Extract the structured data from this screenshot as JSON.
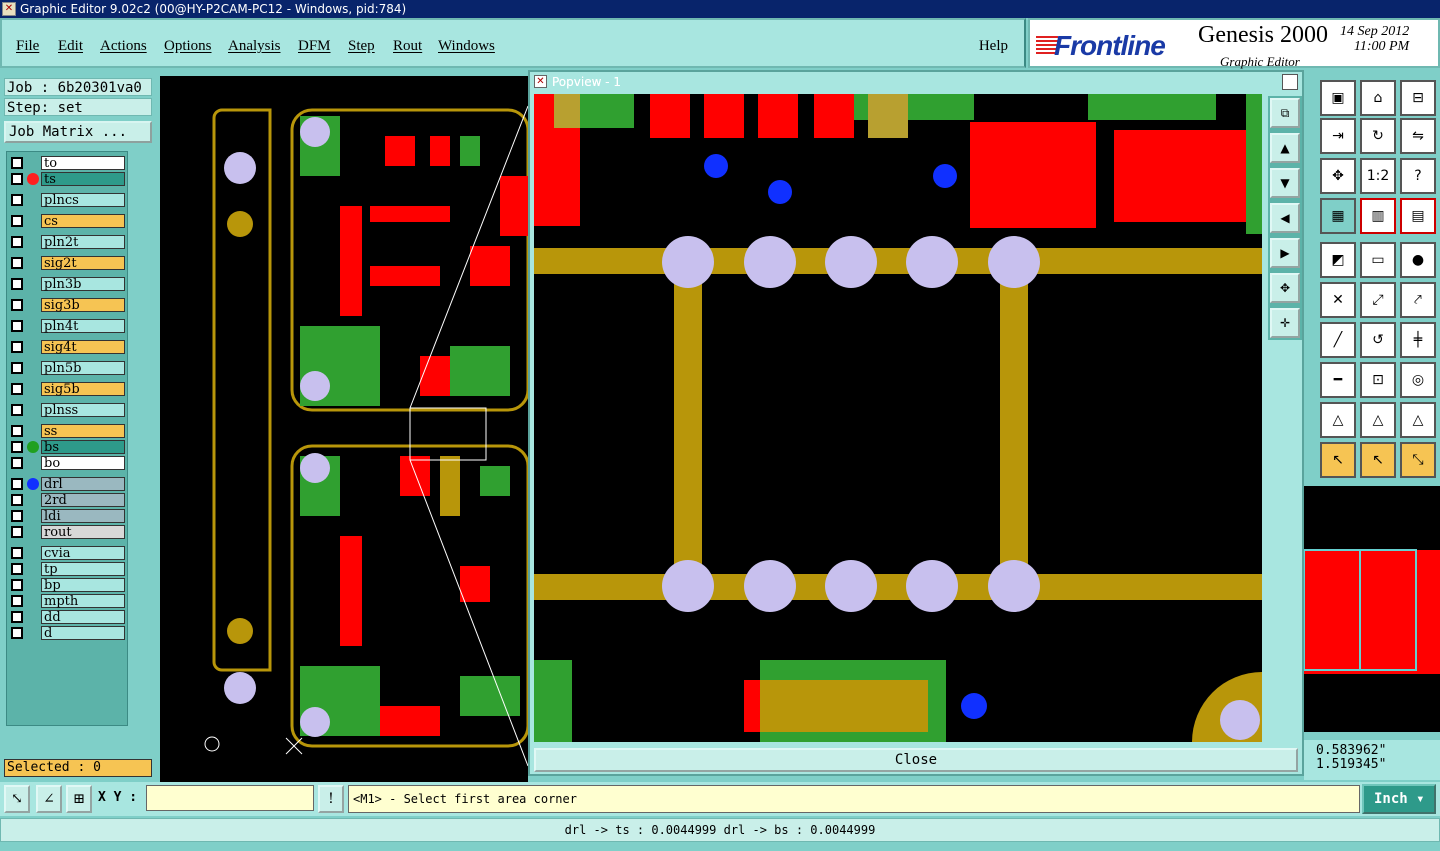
{
  "window": {
    "title": "Graphic Editor 9.02c2 (00@HY-P2CAM-PC12 - Windows, pid:784)"
  },
  "menu": {
    "items": [
      "File",
      "Edit",
      "Actions",
      "Options",
      "Analysis",
      "DFM",
      "Step",
      "Rout",
      "Windows"
    ],
    "help": "Help"
  },
  "brand": {
    "logo": "Frontline",
    "product": "Genesis 2000",
    "subtitle": "Graphic Editor",
    "date": "14 Sep 2012",
    "time": "11:00 PM"
  },
  "job": {
    "job_label": "Job : 6b20301va0",
    "step_label": "Step: set",
    "matrix_button": "Job Matrix ..."
  },
  "layers": [
    {
      "name": "to",
      "bg": "#ffffff",
      "dot": ""
    },
    {
      "name": "ts",
      "bg": "#2e9a8a",
      "dot": "#ff2020"
    },
    {
      "name": "plncs",
      "bg": "#a8e6e0",
      "dot": ""
    },
    {
      "name": "cs",
      "bg": "#f6c453",
      "dot": ""
    },
    {
      "name": "pln2t",
      "bg": "#a8e6e0",
      "dot": ""
    },
    {
      "name": "sig2t",
      "bg": "#f6c453",
      "dot": ""
    },
    {
      "name": "pln3b",
      "bg": "#a8e6e0",
      "dot": ""
    },
    {
      "name": "sig3b",
      "bg": "#f6c453",
      "dot": ""
    },
    {
      "name": "pln4t",
      "bg": "#a8e6e0",
      "dot": ""
    },
    {
      "name": "sig4t",
      "bg": "#f6c453",
      "dot": ""
    },
    {
      "name": "pln5b",
      "bg": "#a8e6e0",
      "dot": ""
    },
    {
      "name": "sig5b",
      "bg": "#f6c453",
      "dot": ""
    },
    {
      "name": "plnss",
      "bg": "#a8e6e0",
      "dot": ""
    },
    {
      "name": "ss",
      "bg": "#f6c453",
      "dot": ""
    },
    {
      "name": "bs",
      "bg": "#2e9a8a",
      "dot": "#20a020"
    },
    {
      "name": "bo",
      "bg": "#ffffff",
      "dot": ""
    },
    {
      "name": "drl",
      "bg": "#9ab8c0",
      "dot": "#1030ff"
    },
    {
      "name": "2rd",
      "bg": "#9ab8c0",
      "dot": ""
    },
    {
      "name": "ldi",
      "bg": "#9ab8c0",
      "dot": ""
    },
    {
      "name": "rout",
      "bg": "#d8d8d8",
      "dot": ""
    },
    {
      "name": "cvia",
      "bg": "#a8e6e0",
      "dot": ""
    },
    {
      "name": "tp",
      "bg": "#a8e6e0",
      "dot": ""
    },
    {
      "name": "bp",
      "bg": "#a8e6e0",
      "dot": ""
    },
    {
      "name": "mpth",
      "bg": "#a8e6e0",
      "dot": ""
    },
    {
      "name": "dd",
      "bg": "#a8e6e0",
      "dot": ""
    },
    {
      "name": "d",
      "bg": "#a8e6e0",
      "dot": ""
    }
  ],
  "selected": "Selected : 0",
  "popview": {
    "title": "Popview - 1",
    "close_label": "Close"
  },
  "coords": {
    "x": "0.583962\"",
    "y": "1.519345\""
  },
  "bottom": {
    "xy_label": "X Y :",
    "xy_value": "",
    "prompt": "<M1> - Select first area corner",
    "unit": "Inch"
  },
  "status": "drl -> ts : 0.0044999   drl -> bs : 0.0044999"
}
